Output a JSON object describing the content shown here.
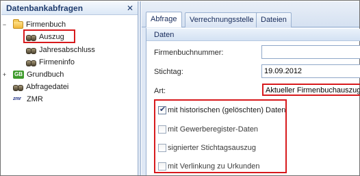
{
  "left_panel": {
    "title": "Datenbankabfragen",
    "close_glyph": "✕",
    "tree": [
      {
        "label": "Firmenbuch",
        "icon": "folder-open-icon",
        "expander": "−"
      },
      {
        "label": "Auszug",
        "icon": "binoculars-icon",
        "selected": true
      },
      {
        "label": "Jahresabschluss",
        "icon": "binoculars-icon"
      },
      {
        "label": "Firmeninfo",
        "icon": "binoculars-icon"
      },
      {
        "label": "Grundbuch",
        "icon": "gb-icon",
        "icon_text": "GB",
        "expander": "+"
      },
      {
        "label": "Abfragedatei",
        "icon": "binoculars-icon"
      },
      {
        "label": "ZMR",
        "icon": "zmr-icon",
        "icon_text": "zmr"
      }
    ]
  },
  "tabs": [
    {
      "label": "Abfrage",
      "active": true
    },
    {
      "label": "Verrechnungsstelle",
      "active": false
    },
    {
      "label": "Dateien",
      "active": false
    }
  ],
  "form": {
    "section_title": "Daten",
    "fields": [
      {
        "label": "Firmenbuchnummer:",
        "value": ""
      },
      {
        "label": "Stichtag:",
        "value": "19.09.2012"
      },
      {
        "label": "Art:",
        "value": "Aktueller Firmenbuchauszug"
      }
    ],
    "checkboxes": [
      {
        "label": "mit historischen (gelöschten) Daten",
        "checked": true
      },
      {
        "label": "mit Gewerberegister-Daten",
        "checked": false
      },
      {
        "label": "signierter Stichtagsauszug",
        "checked": false
      },
      {
        "label": "mit Verlinkung zu Urkunden",
        "checked": false
      }
    ]
  },
  "colors": {
    "highlight": "#d7191c",
    "panel_blue": "#dfe8f5",
    "title_text": "#1f3c6e"
  }
}
